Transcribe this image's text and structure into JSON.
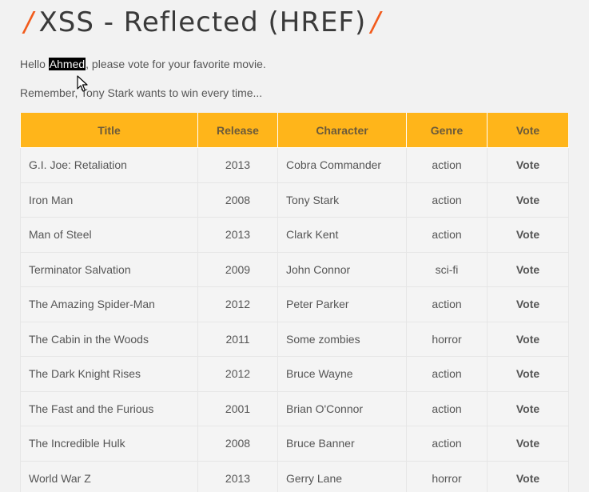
{
  "title": {
    "slash_left": "/",
    "text": "XSS - Reflected (HREF)",
    "slash_right": "/"
  },
  "intro": {
    "hello": "Hello ",
    "name": "Ahmed",
    "rest": ", please vote for your favorite movie.",
    "remember": "Remember, Tony Stark wants to win every time..."
  },
  "table": {
    "headers": [
      "Title",
      "Release",
      "Character",
      "Genre",
      "Vote"
    ],
    "rows": [
      {
        "title": "G.I. Joe: Retaliation",
        "release": "2013",
        "character": "Cobra Commander",
        "genre": "action",
        "vote": "Vote"
      },
      {
        "title": "Iron Man",
        "release": "2008",
        "character": "Tony Stark",
        "genre": "action",
        "vote": "Vote"
      },
      {
        "title": "Man of Steel",
        "release": "2013",
        "character": "Clark Kent",
        "genre": "action",
        "vote": "Vote"
      },
      {
        "title": "Terminator Salvation",
        "release": "2009",
        "character": "John Connor",
        "genre": "sci-fi",
        "vote": "Vote"
      },
      {
        "title": "The Amazing Spider-Man",
        "release": "2012",
        "character": "Peter Parker",
        "genre": "action",
        "vote": "Vote"
      },
      {
        "title": "The Cabin in the Woods",
        "release": "2011",
        "character": "Some zombies",
        "genre": "horror",
        "vote": "Vote"
      },
      {
        "title": "The Dark Knight Rises",
        "release": "2012",
        "character": "Bruce Wayne",
        "genre": "action",
        "vote": "Vote"
      },
      {
        "title": "The Fast and the Furious",
        "release": "2001",
        "character": "Brian O'Connor",
        "genre": "action",
        "vote": "Vote"
      },
      {
        "title": "The Incredible Hulk",
        "release": "2008",
        "character": "Bruce Banner",
        "genre": "action",
        "vote": "Vote"
      },
      {
        "title": "World War Z",
        "release": "2013",
        "character": "Gerry Lane",
        "genre": "horror",
        "vote": "Vote"
      }
    ]
  },
  "colors": {
    "accent_slash": "#f25b1c",
    "header_bg": "#ffb51a",
    "page_bg": "#f2f2f2"
  },
  "icons": {
    "cursor": "mouse-pointer-icon"
  }
}
